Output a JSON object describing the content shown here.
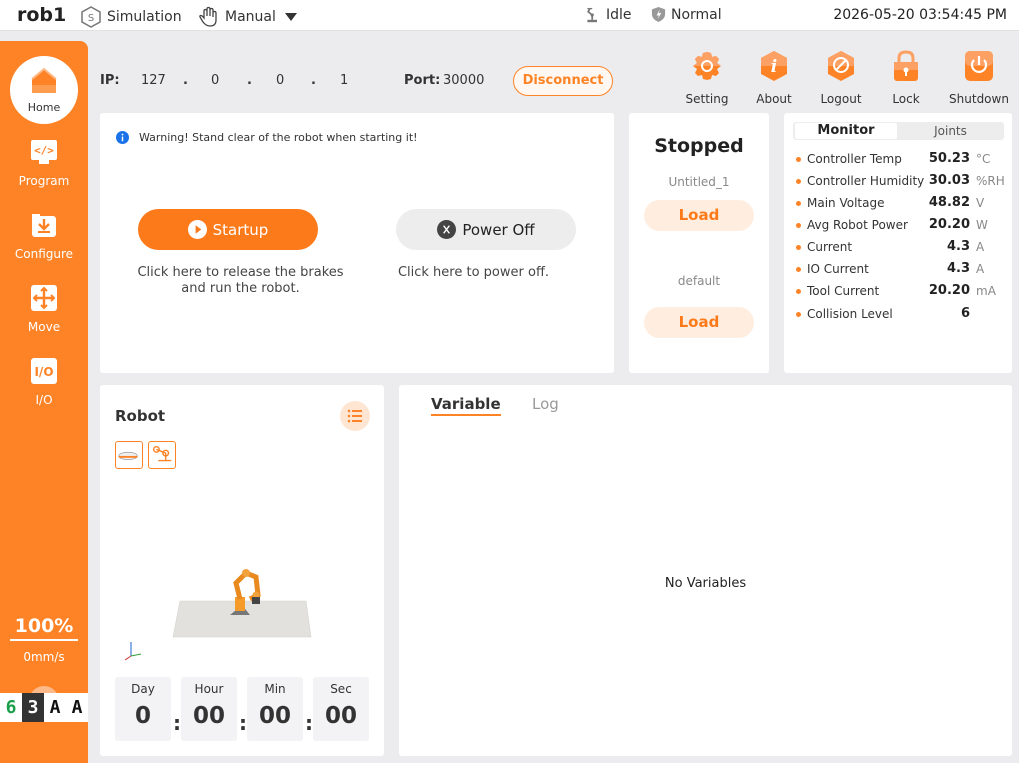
{
  "topbar": {
    "title": "rob1",
    "simulation": "Simulation",
    "manual": "Manual",
    "state": "Idle",
    "safety": "Normal",
    "clock": "2026-05-20 03:54:45 PM"
  },
  "sidebar": {
    "home": "Home",
    "program": "Program",
    "configure": "Configure",
    "move": "Move",
    "io": "I/O",
    "speed_percent": "100%",
    "speed_mm": "0mm/s"
  },
  "badges": [
    "6",
    "3",
    "A",
    "A"
  ],
  "connection": {
    "ip_label": "IP:",
    "ip": [
      "127",
      "0",
      "0",
      "1"
    ],
    "dot": ".",
    "port_label": "Port:",
    "port": "30000",
    "disconnect": "Disconnect"
  },
  "toolbar": {
    "setting": "Setting",
    "about": "About",
    "logout": "Logout",
    "lock": "Lock",
    "shutdown": "Shutdown"
  },
  "power": {
    "warning": "Warning! Stand clear of the robot when starting it!",
    "startup": "Startup",
    "power_off": "Power Off",
    "startup_hint_1": "Click here to release the brakes",
    "startup_hint_2": "and run the robot.",
    "power_off_hint": "Click here to power off."
  },
  "program": {
    "status": "Stopped",
    "program_name": "Untitled_1",
    "load": "Load",
    "config_name": "default"
  },
  "monitor": {
    "tabs": [
      "Monitor",
      "Joints"
    ],
    "rows": [
      {
        "label": "Controller Temp",
        "value": "50.23",
        "unit": "°C"
      },
      {
        "label": "Controller Humidity",
        "value": "30.03",
        "unit": "%RH"
      },
      {
        "label": "Main Voltage",
        "value": "48.82",
        "unit": "V"
      },
      {
        "label": "Avg Robot Power",
        "value": "20.20",
        "unit": "W"
      },
      {
        "label": "Current",
        "value": "4.3",
        "unit": "A"
      },
      {
        "label": "IO Current",
        "value": "4.3",
        "unit": "A"
      },
      {
        "label": "Tool Current",
        "value": "20.20",
        "unit": "mA"
      },
      {
        "label": "Collision Level",
        "value": "6",
        "unit": ""
      }
    ]
  },
  "robot": {
    "title": "Robot",
    "timer": [
      {
        "label": "Day",
        "value": "0"
      },
      {
        "label": "Hour",
        "value": "00"
      },
      {
        "label": "Min",
        "value": "00"
      },
      {
        "label": "Sec",
        "value": "00"
      }
    ],
    "colon": ":"
  },
  "variables": {
    "tabs": [
      "Variable",
      "Log"
    ],
    "empty": "No Variables"
  },
  "colors": {
    "accent": "#fd8326",
    "accent_light": "#ffeee0",
    "background": "#ececee"
  }
}
